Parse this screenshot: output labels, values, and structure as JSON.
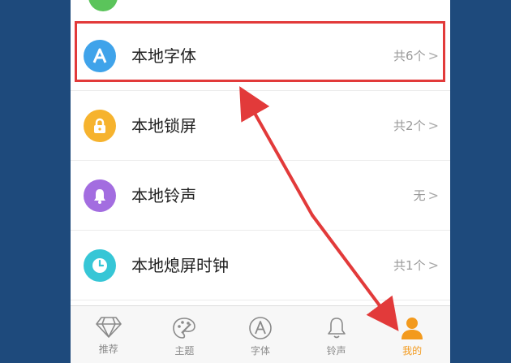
{
  "list": {
    "items": [
      {
        "label": "本地字体",
        "meta": "共6个",
        "icon": "font-a-icon",
        "color": "#3fa3ea"
      },
      {
        "label": "本地锁屏",
        "meta": "共2个",
        "icon": "lock-icon",
        "color": "#f6b32e"
      },
      {
        "label": "本地铃声",
        "meta": "无",
        "icon": "bell-icon",
        "color": "#a36de0"
      },
      {
        "label": "本地熄屏时钟",
        "meta": "共1个",
        "icon": "clock-icon",
        "color": "#36c6d6"
      }
    ],
    "chevron": ">"
  },
  "tabbar": {
    "tabs": [
      {
        "label": "推荐",
        "icon": "diamond-icon"
      },
      {
        "label": "主题",
        "icon": "palette-icon"
      },
      {
        "label": "字体",
        "icon": "font-a-icon"
      },
      {
        "label": "铃声",
        "icon": "bell-icon"
      },
      {
        "label": "我的",
        "icon": "person-icon",
        "active": true
      }
    ]
  },
  "colors": {
    "background": "#1e4a7c",
    "highlight": "#e23a3a",
    "active_tab": "#f39a1d"
  }
}
